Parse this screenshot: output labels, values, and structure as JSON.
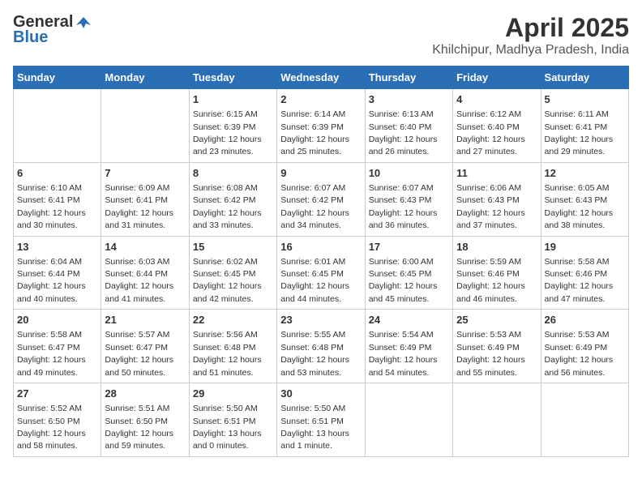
{
  "logo": {
    "general": "General",
    "blue": "Blue"
  },
  "title": "April 2025",
  "subtitle": "Khilchipur, Madhya Pradesh, India",
  "days_of_week": [
    "Sunday",
    "Monday",
    "Tuesday",
    "Wednesday",
    "Thursday",
    "Friday",
    "Saturday"
  ],
  "weeks": [
    [
      {
        "day": "",
        "sunrise": "",
        "sunset": "",
        "daylight": ""
      },
      {
        "day": "",
        "sunrise": "",
        "sunset": "",
        "daylight": ""
      },
      {
        "day": "1",
        "sunrise": "Sunrise: 6:15 AM",
        "sunset": "Sunset: 6:39 PM",
        "daylight": "Daylight: 12 hours and 23 minutes."
      },
      {
        "day": "2",
        "sunrise": "Sunrise: 6:14 AM",
        "sunset": "Sunset: 6:39 PM",
        "daylight": "Daylight: 12 hours and 25 minutes."
      },
      {
        "day": "3",
        "sunrise": "Sunrise: 6:13 AM",
        "sunset": "Sunset: 6:40 PM",
        "daylight": "Daylight: 12 hours and 26 minutes."
      },
      {
        "day": "4",
        "sunrise": "Sunrise: 6:12 AM",
        "sunset": "Sunset: 6:40 PM",
        "daylight": "Daylight: 12 hours and 27 minutes."
      },
      {
        "day": "5",
        "sunrise": "Sunrise: 6:11 AM",
        "sunset": "Sunset: 6:41 PM",
        "daylight": "Daylight: 12 hours and 29 minutes."
      }
    ],
    [
      {
        "day": "6",
        "sunrise": "Sunrise: 6:10 AM",
        "sunset": "Sunset: 6:41 PM",
        "daylight": "Daylight: 12 hours and 30 minutes."
      },
      {
        "day": "7",
        "sunrise": "Sunrise: 6:09 AM",
        "sunset": "Sunset: 6:41 PM",
        "daylight": "Daylight: 12 hours and 31 minutes."
      },
      {
        "day": "8",
        "sunrise": "Sunrise: 6:08 AM",
        "sunset": "Sunset: 6:42 PM",
        "daylight": "Daylight: 12 hours and 33 minutes."
      },
      {
        "day": "9",
        "sunrise": "Sunrise: 6:07 AM",
        "sunset": "Sunset: 6:42 PM",
        "daylight": "Daylight: 12 hours and 34 minutes."
      },
      {
        "day": "10",
        "sunrise": "Sunrise: 6:07 AM",
        "sunset": "Sunset: 6:43 PM",
        "daylight": "Daylight: 12 hours and 36 minutes."
      },
      {
        "day": "11",
        "sunrise": "Sunrise: 6:06 AM",
        "sunset": "Sunset: 6:43 PM",
        "daylight": "Daylight: 12 hours and 37 minutes."
      },
      {
        "day": "12",
        "sunrise": "Sunrise: 6:05 AM",
        "sunset": "Sunset: 6:43 PM",
        "daylight": "Daylight: 12 hours and 38 minutes."
      }
    ],
    [
      {
        "day": "13",
        "sunrise": "Sunrise: 6:04 AM",
        "sunset": "Sunset: 6:44 PM",
        "daylight": "Daylight: 12 hours and 40 minutes."
      },
      {
        "day": "14",
        "sunrise": "Sunrise: 6:03 AM",
        "sunset": "Sunset: 6:44 PM",
        "daylight": "Daylight: 12 hours and 41 minutes."
      },
      {
        "day": "15",
        "sunrise": "Sunrise: 6:02 AM",
        "sunset": "Sunset: 6:45 PM",
        "daylight": "Daylight: 12 hours and 42 minutes."
      },
      {
        "day": "16",
        "sunrise": "Sunrise: 6:01 AM",
        "sunset": "Sunset: 6:45 PM",
        "daylight": "Daylight: 12 hours and 44 minutes."
      },
      {
        "day": "17",
        "sunrise": "Sunrise: 6:00 AM",
        "sunset": "Sunset: 6:45 PM",
        "daylight": "Daylight: 12 hours and 45 minutes."
      },
      {
        "day": "18",
        "sunrise": "Sunrise: 5:59 AM",
        "sunset": "Sunset: 6:46 PM",
        "daylight": "Daylight: 12 hours and 46 minutes."
      },
      {
        "day": "19",
        "sunrise": "Sunrise: 5:58 AM",
        "sunset": "Sunset: 6:46 PM",
        "daylight": "Daylight: 12 hours and 47 minutes."
      }
    ],
    [
      {
        "day": "20",
        "sunrise": "Sunrise: 5:58 AM",
        "sunset": "Sunset: 6:47 PM",
        "daylight": "Daylight: 12 hours and 49 minutes."
      },
      {
        "day": "21",
        "sunrise": "Sunrise: 5:57 AM",
        "sunset": "Sunset: 6:47 PM",
        "daylight": "Daylight: 12 hours and 50 minutes."
      },
      {
        "day": "22",
        "sunrise": "Sunrise: 5:56 AM",
        "sunset": "Sunset: 6:48 PM",
        "daylight": "Daylight: 12 hours and 51 minutes."
      },
      {
        "day": "23",
        "sunrise": "Sunrise: 5:55 AM",
        "sunset": "Sunset: 6:48 PM",
        "daylight": "Daylight: 12 hours and 53 minutes."
      },
      {
        "day": "24",
        "sunrise": "Sunrise: 5:54 AM",
        "sunset": "Sunset: 6:49 PM",
        "daylight": "Daylight: 12 hours and 54 minutes."
      },
      {
        "day": "25",
        "sunrise": "Sunrise: 5:53 AM",
        "sunset": "Sunset: 6:49 PM",
        "daylight": "Daylight: 12 hours and 55 minutes."
      },
      {
        "day": "26",
        "sunrise": "Sunrise: 5:53 AM",
        "sunset": "Sunset: 6:49 PM",
        "daylight": "Daylight: 12 hours and 56 minutes."
      }
    ],
    [
      {
        "day": "27",
        "sunrise": "Sunrise: 5:52 AM",
        "sunset": "Sunset: 6:50 PM",
        "daylight": "Daylight: 12 hours and 58 minutes."
      },
      {
        "day": "28",
        "sunrise": "Sunrise: 5:51 AM",
        "sunset": "Sunset: 6:50 PM",
        "daylight": "Daylight: 12 hours and 59 minutes."
      },
      {
        "day": "29",
        "sunrise": "Sunrise: 5:50 AM",
        "sunset": "Sunset: 6:51 PM",
        "daylight": "Daylight: 13 hours and 0 minutes."
      },
      {
        "day": "30",
        "sunrise": "Sunrise: 5:50 AM",
        "sunset": "Sunset: 6:51 PM",
        "daylight": "Daylight: 13 hours and 1 minute."
      },
      {
        "day": "",
        "sunrise": "",
        "sunset": "",
        "daylight": ""
      },
      {
        "day": "",
        "sunrise": "",
        "sunset": "",
        "daylight": ""
      },
      {
        "day": "",
        "sunrise": "",
        "sunset": "",
        "daylight": ""
      }
    ]
  ]
}
